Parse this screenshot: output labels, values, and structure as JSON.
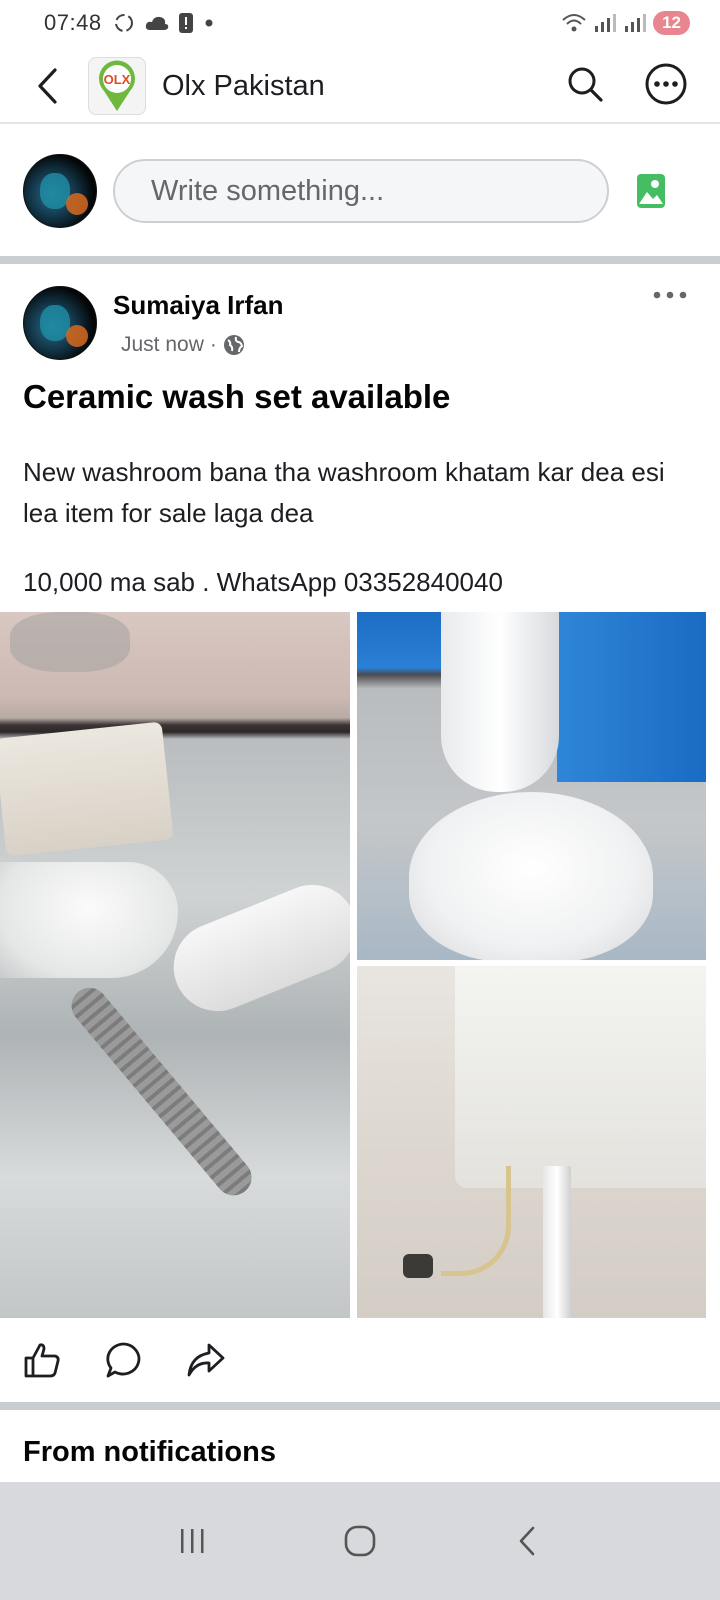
{
  "status_bar": {
    "time": "07:48",
    "battery": "12"
  },
  "header": {
    "group_name": "Olx Pakistan",
    "logo_text": "OLX"
  },
  "composer": {
    "placeholder": "Write something..."
  },
  "post": {
    "author": "Sumaiya Irfan",
    "time": "Just now",
    "separator": "·",
    "title": "Ceramic wash set available",
    "body_line_1": "New washroom bana tha washroom khatam kar dea esi lea item for sale laga dea",
    "body_line_2": "10,000 ma sab . WhatsApp 03352840040"
  },
  "sections": {
    "from_notifications": "From notifications"
  },
  "colors": {
    "accent_blue": "#1877f2",
    "photo_icon_green": "#45bd62",
    "text_primary": "#050505",
    "text_secondary": "#65676b"
  }
}
